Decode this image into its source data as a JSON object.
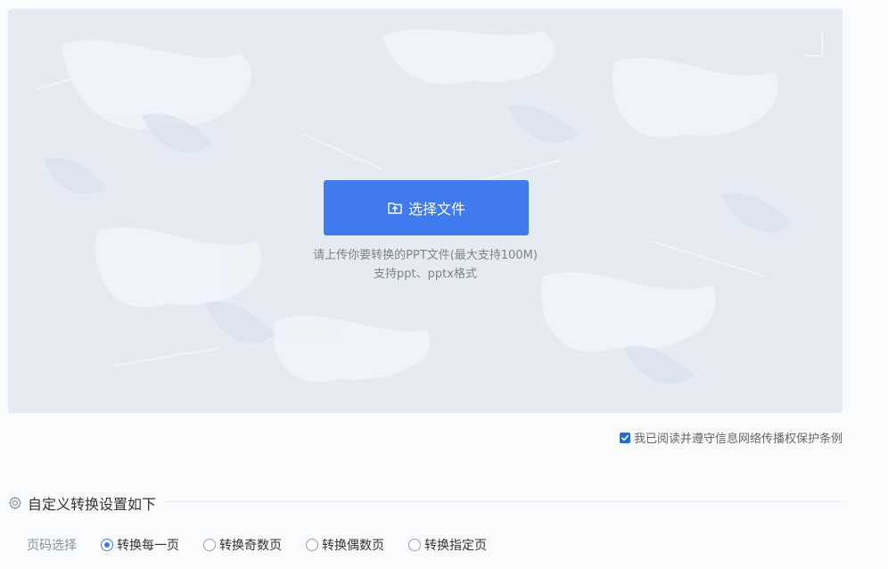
{
  "upload": {
    "button_label": "选择文件",
    "button_icon": "folder-upload-icon",
    "hint_line1": "请上传你要转换的PPT文件(最大支持100M)",
    "hint_line2": "支持ppt、pptx格式"
  },
  "agreement": {
    "checked": true,
    "label": "我已阅读并遵守信息网络传播权保护条例"
  },
  "settings": {
    "title": "自定义转换设置如下",
    "icon": "gear-icon",
    "page_select": {
      "label": "页码选择",
      "selected": 0,
      "options": [
        {
          "label": "转换每一页"
        },
        {
          "label": "转换奇数页"
        },
        {
          "label": "转换偶数页"
        },
        {
          "label": "转换指定页"
        }
      ]
    }
  },
  "colors": {
    "accent": "#3f7af0",
    "dropzone_bg": "#e6ebf3",
    "checkbox": "#1f6fd1"
  }
}
